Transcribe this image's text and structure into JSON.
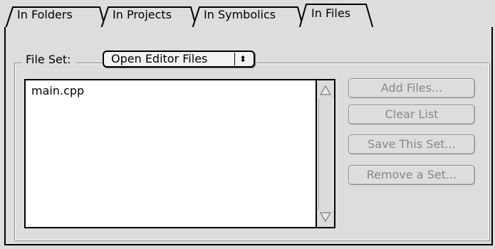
{
  "tabs": [
    {
      "label": "In Folders",
      "selected": false
    },
    {
      "label": "In Projects",
      "selected": false
    },
    {
      "label": "In Symbolics",
      "selected": false
    },
    {
      "label": "In Files",
      "selected": true
    }
  ],
  "file_set": {
    "label": "File Set:",
    "selected": "Open Editor Files",
    "arrows_glyph": "⬍"
  },
  "file_list": {
    "items": [
      "main.cpp"
    ]
  },
  "buttons": {
    "add_files": "Add Files...",
    "clear_list": "Clear List",
    "save_set": "Save This Set...",
    "remove_set": "Remove a Set...",
    "enabled": false
  },
  "colors": {
    "background": "#dddddd",
    "disabled_text": "#888888"
  }
}
